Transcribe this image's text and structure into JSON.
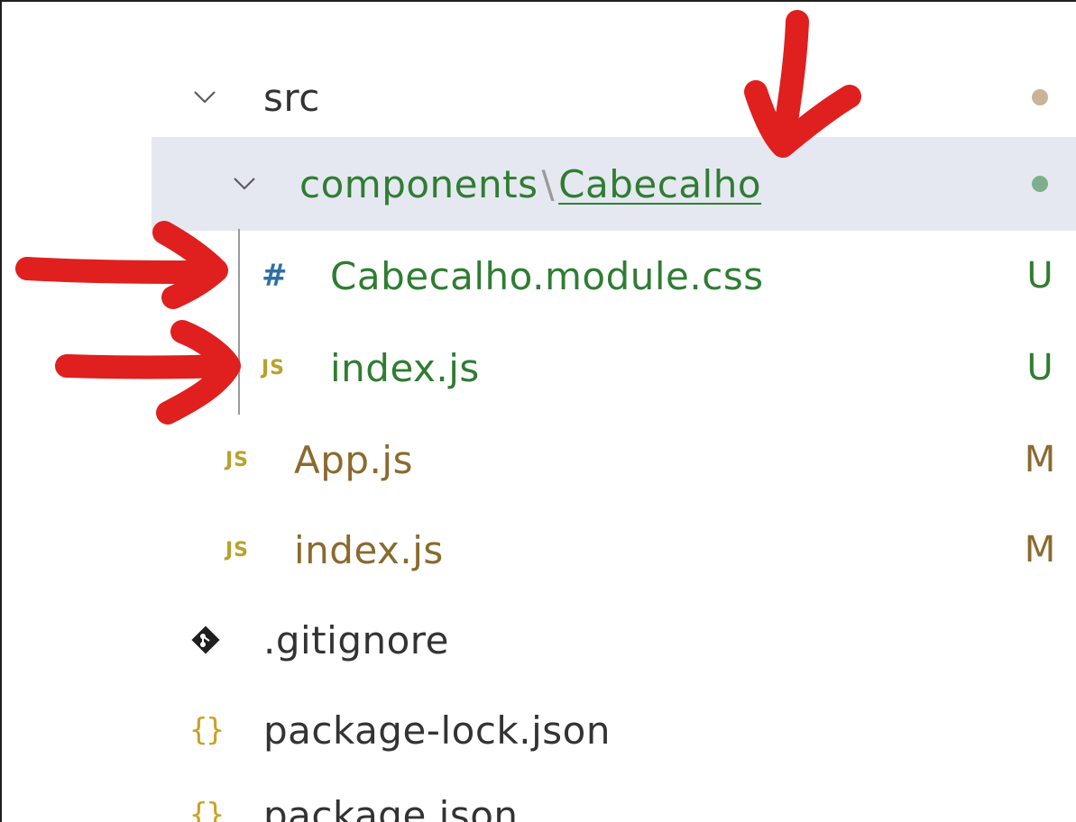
{
  "colors": {
    "modified": "#8a6a2e",
    "untracked": "#2f7d32",
    "folder_text": "#333333",
    "js_icon": "#b8a22a",
    "css_icon": "#2f6fa5",
    "json_icon": "#c9a227",
    "git_icon": "#1f1f1f",
    "dot_modified": "#c9b497",
    "dot_untracked": "#7faf8a",
    "annotation": "#e01f1f",
    "selection": "#e5e8f1"
  },
  "tree": {
    "src": {
      "label": "src",
      "icon": "chevron-down-icon"
    },
    "components": {
      "label_first": "components",
      "separator": "\\",
      "label_second": "Cabecalho",
      "icon": "chevron-down-icon"
    },
    "css_file": {
      "label": "Cabecalho.module.css",
      "icon_glyph": "#",
      "badge": "U"
    },
    "inner_index": {
      "label": "index.js",
      "icon_glyph": "JS",
      "badge": "U"
    },
    "app": {
      "label": "App.js",
      "icon_glyph": "JS",
      "badge": "M"
    },
    "outer_index": {
      "label": "index.js",
      "icon_glyph": "JS",
      "badge": "M"
    },
    "gitignore": {
      "label": ".gitignore",
      "icon": "git-diamond-icon"
    },
    "package_lock": {
      "label": "package-lock.json",
      "icon_glyph": "{}"
    },
    "package": {
      "label": "package.json",
      "icon_glyph": "{}"
    }
  }
}
